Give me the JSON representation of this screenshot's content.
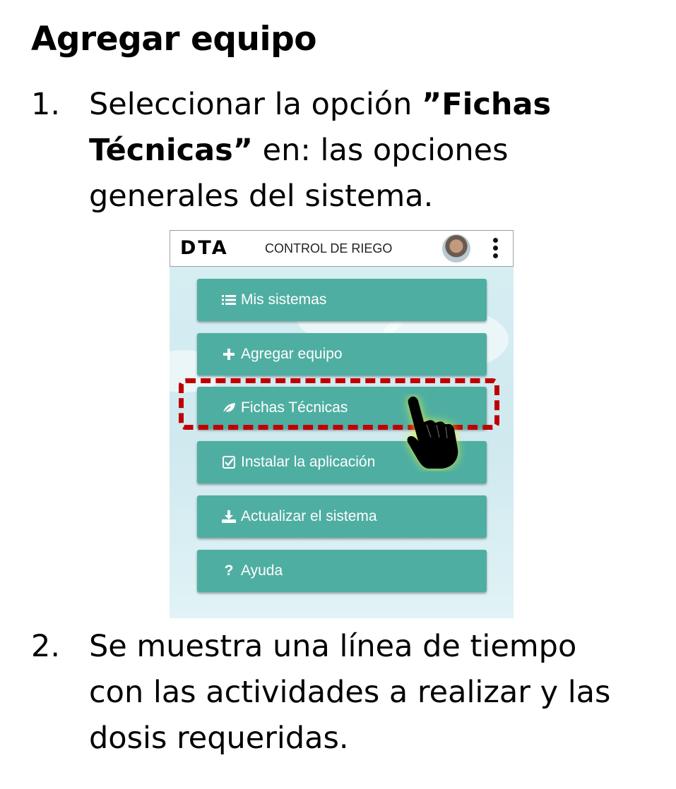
{
  "heading": "Agregar equipo",
  "step1": {
    "number": "1.",
    "line1_pre": "Seleccionar la opción ",
    "line1_bold": "”Fichas",
    "line2_bold": "Técnicas”",
    "line2_post": " en: las opciones",
    "line3": "generales del sistema."
  },
  "app": {
    "logo": "DTA",
    "title": "CONTROL DE RIEGO",
    "menu": [
      {
        "label": "Mis sistemas",
        "icon": "list-icon"
      },
      {
        "label": "Agregar equipo",
        "icon": "plus-icon"
      },
      {
        "label": "Fichas Técnicas",
        "icon": "leaf-icon"
      },
      {
        "label": "Instalar la aplicación",
        "icon": "check-square-icon"
      },
      {
        "label": "Actualizar el sistema",
        "icon": "download-icon"
      },
      {
        "label": "Ayuda",
        "icon": "question-icon"
      }
    ]
  },
  "step2": {
    "number": "2.",
    "line1": "Se muestra una línea de tiempo",
    "line2": "con las actividades a realizar y las",
    "line3": "dosis requeridas."
  },
  "colors": {
    "button": "#4faea2",
    "highlight": "#c00000",
    "hand_glow": "#d7ef3a"
  }
}
